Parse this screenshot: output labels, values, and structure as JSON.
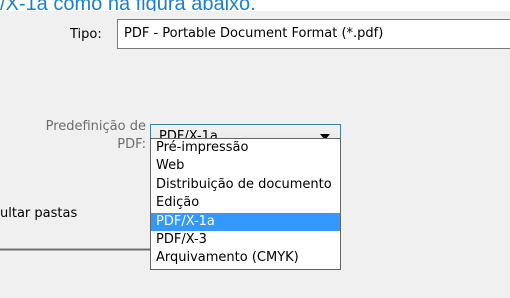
{
  "instruction_text": "/X-1a como na figura abaixo.",
  "tipo": {
    "label": "Tipo:",
    "value": "PDF - Portable Document Format (*.pdf)"
  },
  "predefinicao": {
    "label_line1": "Predefinição de",
    "label_line2": "PDF:",
    "value": "PDF/X-1a"
  },
  "consultar_pastas": "ultar pastas",
  "dropdown": {
    "items": [
      {
        "label": "Pré-impressão"
      },
      {
        "label": "Web"
      },
      {
        "label": "Distribuição de documento"
      },
      {
        "label": "Edição"
      },
      {
        "label": "PDF/X-1a"
      },
      {
        "label": "PDF/X-3"
      },
      {
        "label": "Arquivamento (CMYK)"
      }
    ],
    "selected_index": 4
  },
  "colors": {
    "instruction_text": "#1f7fc9",
    "selection": "#3399ff",
    "dialog_bg": "#f0f0f0"
  }
}
